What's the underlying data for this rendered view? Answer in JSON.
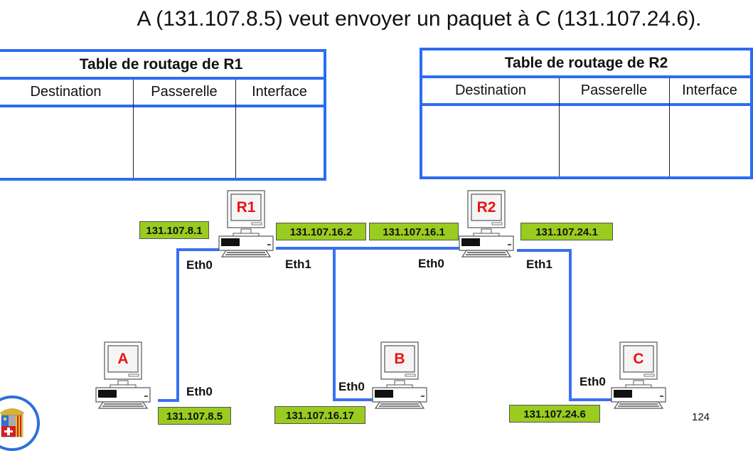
{
  "title": "A (131.107.8.5) veut envoyer un paquet à C (131.107.24.6).",
  "tables": [
    {
      "title": "Table de routage de R1",
      "columns": [
        "Destination",
        "Passerelle",
        "Interface"
      ],
      "rows": []
    },
    {
      "title": "Table de routage de R2",
      "columns": [
        "Destination",
        "Passerelle",
        "Interface"
      ],
      "rows": []
    }
  ],
  "nodes": {
    "R1": {
      "label": "R1",
      "ips": [
        "131.107.8.1",
        "131.107.16.2"
      ],
      "interfaces": [
        "Eth0",
        "Eth1"
      ]
    },
    "R2": {
      "label": "R2",
      "ips": [
        "131.107.16.1",
        "131.107.24.1"
      ],
      "interfaces": [
        "Eth0",
        "Eth1"
      ]
    },
    "A": {
      "label": "A",
      "ip": "131.107.8.5",
      "interface": "Eth0"
    },
    "B": {
      "label": "B",
      "ip": "131.107.16.17",
      "interface": "Eth0"
    },
    "C": {
      "label": "C",
      "ip": "131.107.24.6",
      "interface": "Eth0"
    }
  },
  "colors": {
    "wire": "#3a6ff2",
    "ip_label_bg": "#99cc1f",
    "node_label": "#ee1111",
    "table_border": "#2b6cf2"
  },
  "page_number": "124",
  "logo_icon": "universite-de-savoie-crest-icon"
}
